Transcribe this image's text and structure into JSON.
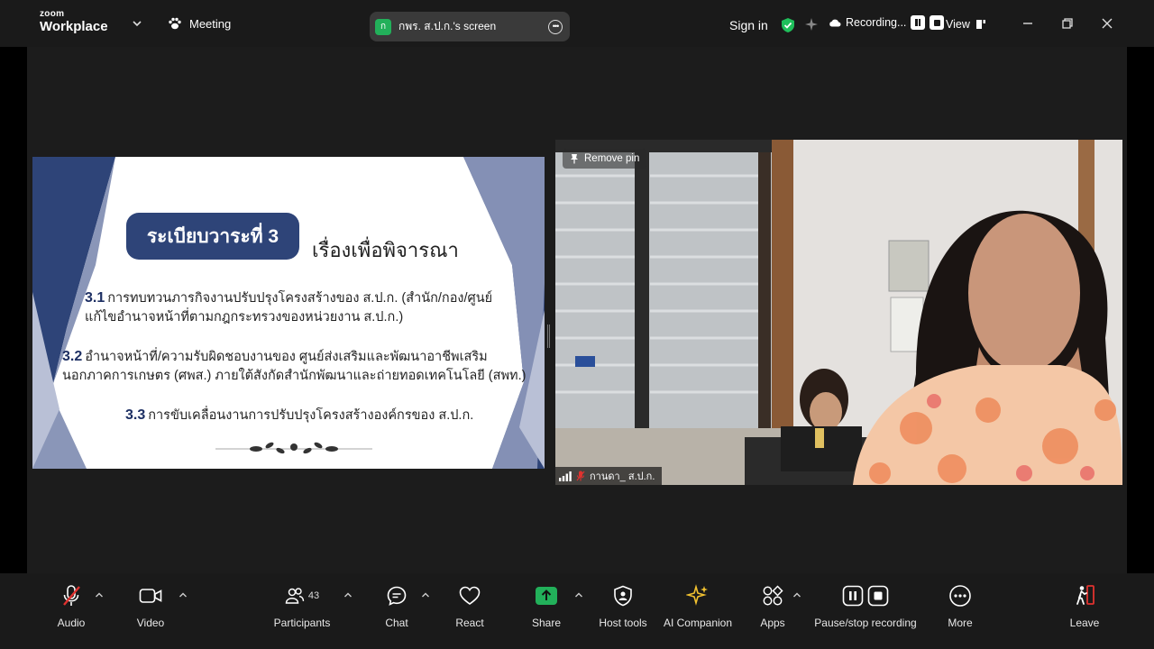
{
  "app": {
    "brand_top": "zoom",
    "brand_bottom": "Workplace",
    "meeting_label": "Meeting"
  },
  "share_pill": {
    "badge": "ก",
    "title": "กพร. ส.ป.ก.'s screen"
  },
  "header": {
    "sign_in": "Sign in",
    "recording": "Recording...",
    "view": "View"
  },
  "slide": {
    "agenda": "ระเบียบวาระที่ 3",
    "heading": "เรื่องเพื่อพิจารณา",
    "items": [
      {
        "num": "3.1",
        "line1": "การทบทวนภารกิจงานปรับปรุงโครงสร้างของ ส.ป.ก. (สำนัก/กอง/ศูนย์",
        "line2": "แก้ไขอำนาจหน้าที่ตามกฎกระทรวงของหน่วยงาน ส.ป.ก.)"
      },
      {
        "num": "3.2",
        "line1": "อำนาจหน้าที่/ความรับผิดชอบงานของ ศูนย์ส่งเสริมและพัฒนาอาชีพเสริม",
        "line2": "นอกภาคการเกษตร (ศพส.) ภายใต้สังกัดสำนักพัฒนาและถ่ายทอดเทคโนโลยี (สพท.)"
      },
      {
        "num": "3.3",
        "line1": "การขับเคลื่อนงานการปรับปรุงโครงสร้างองค์กรของ ส.ป.ก.",
        "line2": ""
      }
    ]
  },
  "video": {
    "remove_pin": "Remove pin",
    "participant_name": "กานดา_ ส.ป.ก."
  },
  "toolbar": {
    "audio": "Audio",
    "video": "Video",
    "participants": "Participants",
    "participants_count": "43",
    "chat": "Chat",
    "react": "React",
    "share": "Share",
    "host_tools": "Host tools",
    "ai_companion": "AI Companion",
    "apps": "Apps",
    "pause_stop": "Pause/stop recording",
    "more": "More",
    "leave": "Leave"
  },
  "colors": {
    "share_green": "#22b05a",
    "shield_green": "#1fbf5b",
    "mute_red": "#e0322f",
    "ai_yellow": "#f2c230",
    "slide_navy": "#2e4478"
  }
}
